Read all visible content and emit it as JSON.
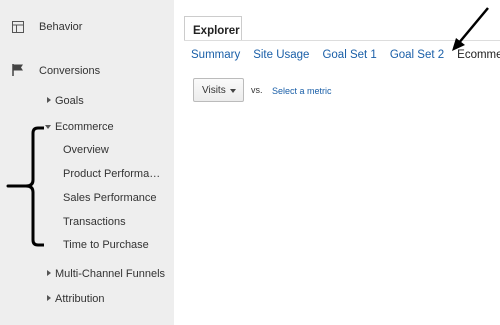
{
  "sidebar": {
    "behavior": "Behavior",
    "conversions": "Conversions",
    "goals": "Goals",
    "ecommerce": "Ecommerce",
    "overview": "Overview",
    "product_performance": "Product Performa…",
    "sales_performance": "Sales Performance",
    "transactions": "Transactions",
    "time_to_purchase": "Time to Purchase",
    "multi_channel_funnels": "Multi-Channel Funnels",
    "attribution": "Attribution"
  },
  "main": {
    "tab": "Explorer",
    "subtabs": [
      "Summary",
      "Site Usage",
      "Goal Set 1",
      "Goal Set 2",
      "Ecommerce"
    ],
    "active_subtab": "Ecommerce",
    "metric_select": "Visits",
    "vs": "vs.",
    "select_metric": "Select a metric"
  },
  "colors": {
    "sidebar_bg": "#eeeeee",
    "link": "#1a5fa8"
  }
}
